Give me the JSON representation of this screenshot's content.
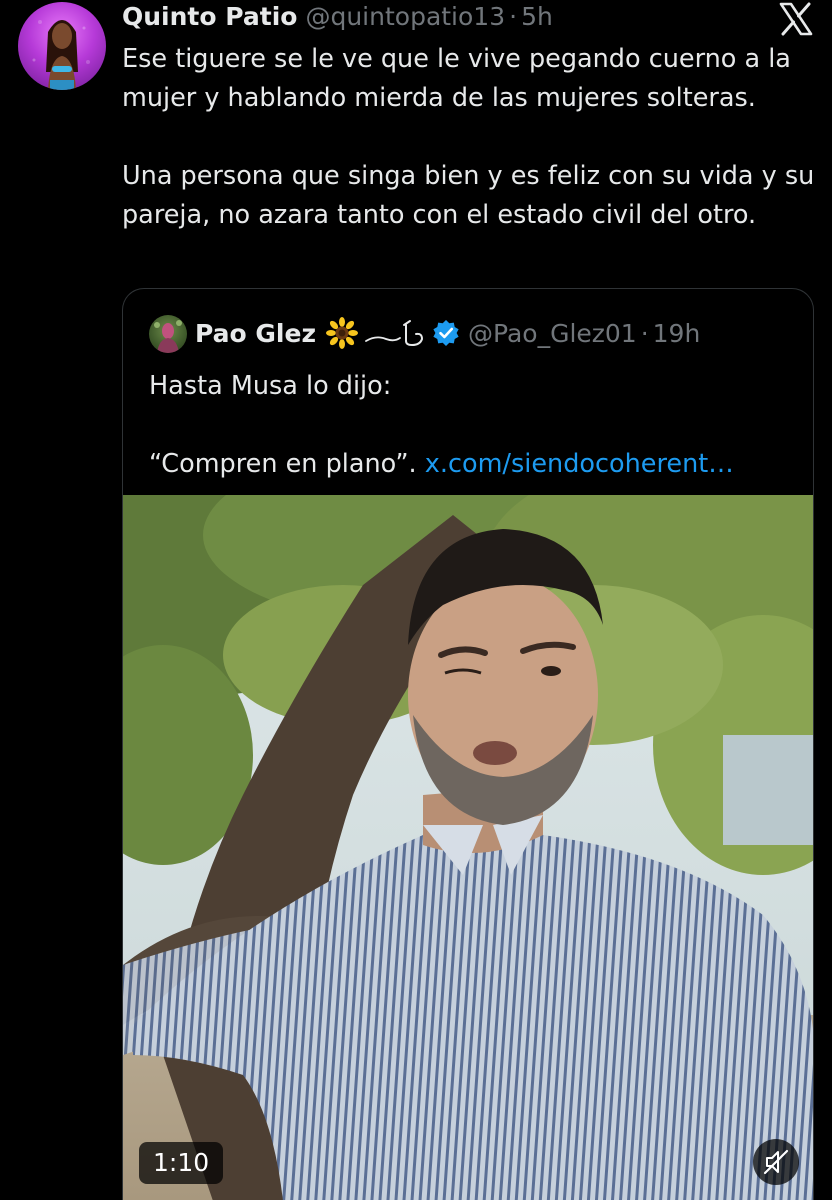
{
  "tweet": {
    "author": {
      "name": "Quinto Patio",
      "handle": "@quintopatio13",
      "avatar_icon": "avatar-image"
    },
    "separator": "·",
    "time": "5h",
    "paragraphs": [
      "Ese tiguere se le ve que le vive pegando cuerno a la mujer y hablando mierda de las mujeres solteras.",
      "Una persona que singa bien y es feliz con su vida y su pareja, no azara tanto con el estado civil del otro."
    ],
    "logo_icon": "x-logo-icon"
  },
  "quoted": {
    "author": {
      "name": "Pao Glez",
      "handle": "@Pao_Glez01",
      "emoji_icon": "sunflower-icon",
      "verified_icon": "verified-badge-icon",
      "verified_color": "#1d9bf0"
    },
    "separator": "·",
    "time": "19h",
    "line1": "Hasta Musa lo dijo:",
    "line2_text": "“Compren en plano”.",
    "line2_link": "x.com/siendocoherent…",
    "link_color": "#1d9bf0"
  },
  "video": {
    "duration": "1:10",
    "mute_icon": "speaker-muted-icon"
  }
}
